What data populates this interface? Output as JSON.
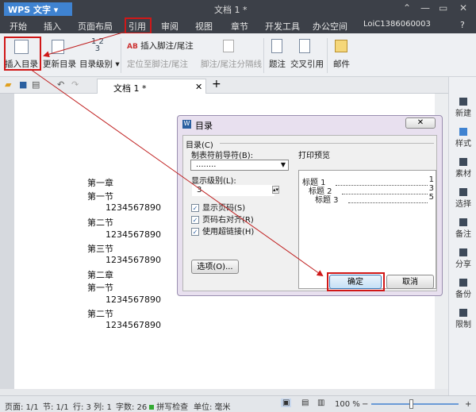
{
  "titlebar": {
    "app": "WPS 文字",
    "doc_title": "文档 1 *"
  },
  "menu": {
    "items": [
      "开始",
      "插入",
      "页面布局",
      "引用",
      "审阅",
      "视图",
      "章节",
      "开发工具",
      "办公空间"
    ],
    "active": "引用",
    "user": "LoiC1386060003"
  },
  "ribbon": {
    "insert_toc": "插入目录",
    "update_toc": "更新目录",
    "toc_level": "目录级别",
    "insert_footnote": "插入脚注/尾注",
    "goto_footnote": "定位至脚注/尾注",
    "footnote_separator": "脚注/尾注分隔线",
    "caption": "题注",
    "cross_ref": "交叉引用",
    "mail": "邮件"
  },
  "tabs": {
    "doc": "文档 1 *"
  },
  "document": {
    "lines": [
      "第一章",
      "第一节",
      "1234567890",
      "第二节",
      "1234567890",
      "第三节",
      "1234567890",
      "第二章",
      "第一节",
      "1234567890",
      "第二节",
      "1234567890"
    ]
  },
  "dialog": {
    "title": "目录",
    "group": "目录(C)",
    "leader_label": "制表符前导符(B):",
    "leader_value": "........",
    "level_label": "显示级别(L):",
    "level_value": "3",
    "show_page": "显示页码(S)",
    "right_align": "页码右对齐(R)",
    "hyperlink": "使用超链接(H)",
    "options": "选项(O)...",
    "preview_label": "打印预览",
    "preview": [
      {
        "text": "标题 1",
        "page": "1"
      },
      {
        "text": "标题 2",
        "page": "3"
      },
      {
        "text": "标题 3",
        "page": "5"
      }
    ],
    "ok": "确定",
    "cancel": "取消"
  },
  "sidebar": [
    "新建",
    "样式",
    "素材",
    "选择",
    "备注",
    "分享",
    "备份",
    "限制"
  ],
  "status": {
    "page": "页面: 1/1",
    "section": "节: 1/1",
    "row": "行: 3",
    "col": "列: 1",
    "words": "字数: 26",
    "spell": "拼写检查",
    "unit": "单位: 毫米",
    "zoom": "100 %"
  },
  "colors": {
    "highlight": "#d01818",
    "accent": "#3f83d1"
  }
}
